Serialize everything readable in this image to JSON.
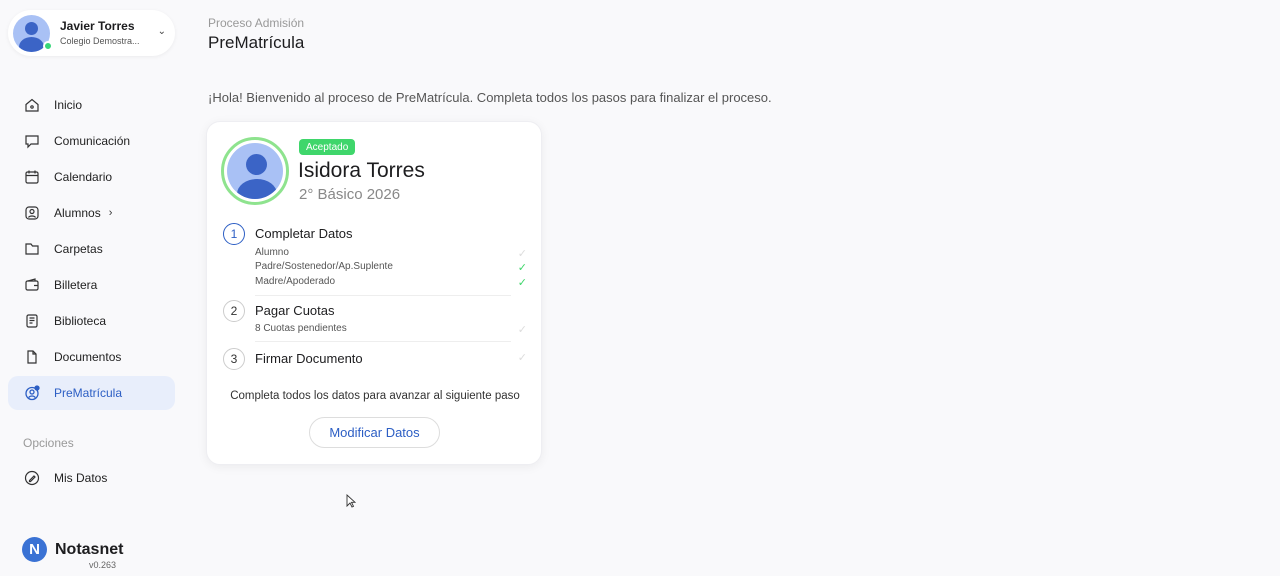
{
  "user": {
    "name": "Javier Torres",
    "school": "Colegio Demostra..."
  },
  "nav": {
    "items": [
      {
        "label": "Inicio",
        "icon": "home-icon"
      },
      {
        "label": "Comunicación",
        "icon": "chat-icon"
      },
      {
        "label": "Calendario",
        "icon": "calendar-icon"
      },
      {
        "label": "Alumnos",
        "icon": "user-icon",
        "has_submenu": true
      },
      {
        "label": "Carpetas",
        "icon": "folder-icon"
      },
      {
        "label": "Billetera",
        "icon": "wallet-icon"
      },
      {
        "label": "Biblioteca",
        "icon": "book-icon"
      },
      {
        "label": "Documentos",
        "icon": "document-icon"
      },
      {
        "label": "PreMatrícula",
        "icon": "enrollment-icon",
        "active": true
      }
    ],
    "options_label": "Opciones",
    "options_items": [
      {
        "label": "Mis Datos",
        "icon": "pencil-icon"
      }
    ]
  },
  "brand": {
    "logo_letter": "N",
    "name": "Notasnet",
    "version": "v0.263"
  },
  "header": {
    "breadcrumb": "Proceso Admisión",
    "title": "PreMatrícula"
  },
  "welcome_text": "¡Hola! Bienvenido al proceso de PreMatrícula. Completa todos los pasos para finalizar el proceso.",
  "student": {
    "status_badge": "Aceptado",
    "name": "Isidora Torres",
    "grade": "2° Básico 2026"
  },
  "steps": [
    {
      "number": "1",
      "title": "Completar Datos",
      "current": true,
      "subitems": [
        {
          "label": "Alumno",
          "done": false
        },
        {
          "label": "Padre/Sostenedor/Ap.Suplente",
          "done": true
        },
        {
          "label": "Madre/Apoderado",
          "done": true
        }
      ]
    },
    {
      "number": "2",
      "title": "Pagar Cuotas",
      "current": false,
      "subitems": [
        {
          "label": "8 Cuotas pendientes",
          "done": false
        }
      ]
    },
    {
      "number": "3",
      "title": "Firmar Documento",
      "current": false,
      "subitems": []
    }
  ],
  "hint": "Completa todos los datos para avanzar al siguiente paso",
  "modify_button": "Modificar Datos",
  "colors": {
    "accent": "#2c5ec4",
    "success": "#3fd66b",
    "active_bg": "#e8eefb"
  }
}
